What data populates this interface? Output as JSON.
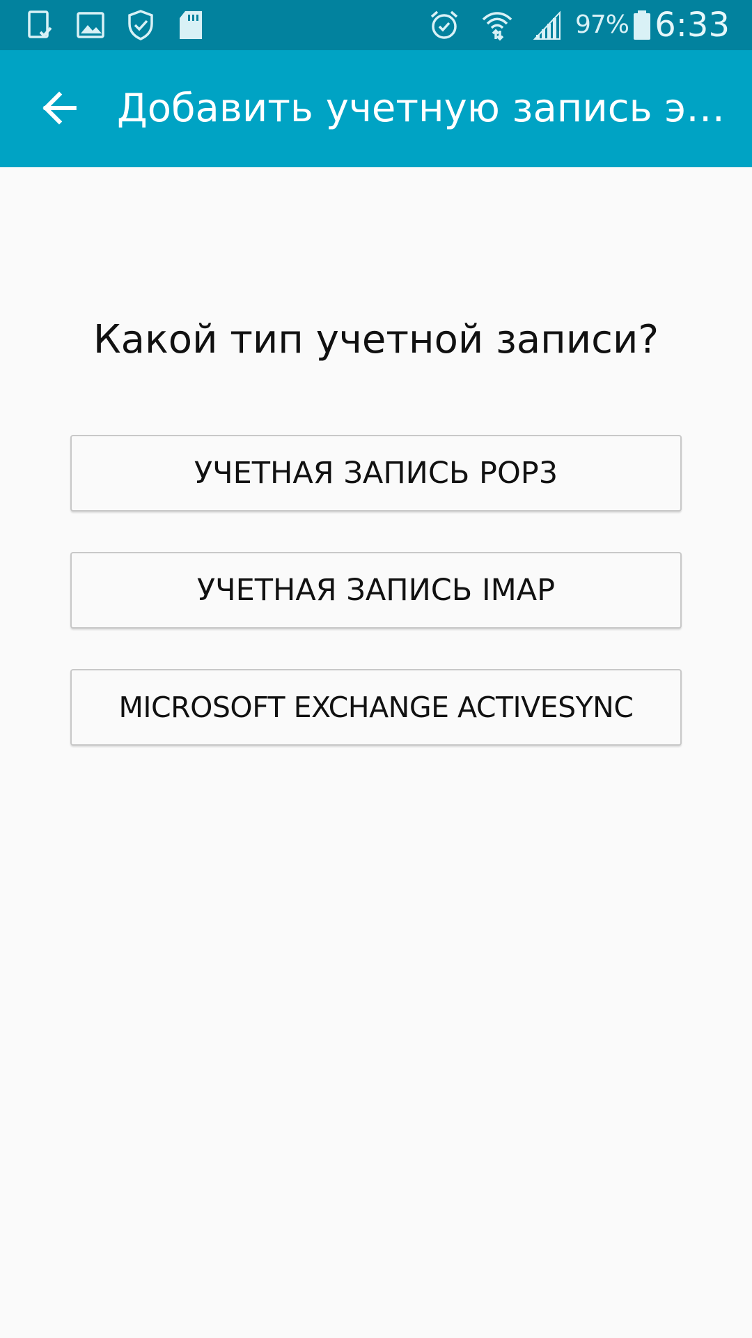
{
  "status_bar": {
    "icons": [
      "tablet-check-icon",
      "image-icon",
      "shield-check-icon",
      "sd-card-icon",
      "alarm-icon",
      "wifi-icon",
      "signal-icon",
      "battery-icon"
    ],
    "battery": "97%",
    "time": "6:33",
    "background": "#02829e"
  },
  "action_bar": {
    "back_icon": "arrow-left-icon",
    "title": "Добавить учетную запись эл...",
    "background": "#00a3c4"
  },
  "content": {
    "question": "Какой тип учетной записи?",
    "options": [
      {
        "label": "УЧЕТНАЯ ЗАПИСЬ POP3"
      },
      {
        "label": "УЧЕТНАЯ ЗАПИСЬ IMAP"
      },
      {
        "label": "MICROSOFT EXCHANGE ACTIVESYNC"
      }
    ]
  }
}
